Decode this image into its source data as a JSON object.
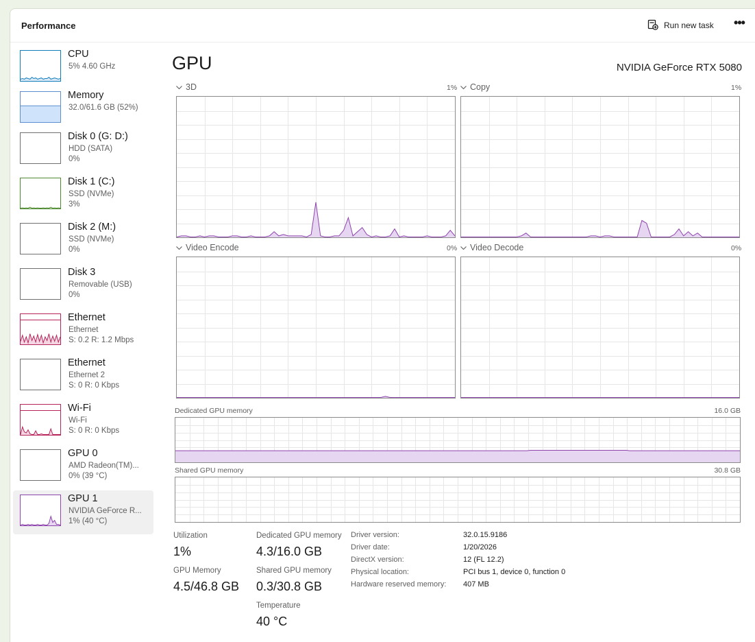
{
  "header": {
    "title": "Performance",
    "run_task_label": "Run new task",
    "more_label": "•••"
  },
  "sidebar": {
    "items": [
      {
        "name": "CPU",
        "sub1": "5%  4.60 GHz",
        "sub2": "",
        "graph": "cpu"
      },
      {
        "name": "Memory",
        "sub1": "32.0/61.6 GB (52%)",
        "sub2": "",
        "graph": "memory"
      },
      {
        "name": "Disk 0 (G: D:)",
        "sub1": "HDD (SATA)",
        "sub2": "0%",
        "graph": "empty"
      },
      {
        "name": "Disk 1 (C:)",
        "sub1": "SSD (NVMe)",
        "sub2": "3%",
        "graph": "disk1"
      },
      {
        "name": "Disk 2 (M:)",
        "sub1": "SSD (NVMe)",
        "sub2": "0%",
        "graph": "empty"
      },
      {
        "name": "Disk 3",
        "sub1": "Removable (USB)",
        "sub2": "0%",
        "graph": "empty"
      },
      {
        "name": "Ethernet",
        "sub1": "Ethernet",
        "sub2": "S: 0.2  R: 1.2 Mbps",
        "graph": "ethernet"
      },
      {
        "name": "Ethernet",
        "sub1": "Ethernet 2",
        "sub2": "S: 0  R: 0 Kbps",
        "graph": "empty"
      },
      {
        "name": "Wi-Fi",
        "sub1": "Wi-Fi",
        "sub2": "S: 0  R: 0 Kbps",
        "graph": "wifi"
      },
      {
        "name": "GPU 0",
        "sub1": "AMD Radeon(TM)...",
        "sub2": "0%  (39 °C)",
        "graph": "empty"
      },
      {
        "name": "GPU 1",
        "sub1": "NVIDIA GeForce R...",
        "sub2": "1%  (40 °C)",
        "graph": "gpu1"
      }
    ],
    "selected_index": 10
  },
  "main": {
    "heading": "GPU",
    "model": "NVIDIA GeForce RTX 5080",
    "engines": [
      {
        "label": "3D",
        "percent": "1%",
        "series": [
          0,
          1,
          1,
          0,
          0,
          1,
          0,
          1,
          1,
          0,
          0,
          0,
          1,
          1,
          0,
          0,
          1,
          0,
          0,
          0,
          1,
          4,
          1,
          2,
          1,
          1,
          1,
          1,
          0,
          2,
          25,
          1,
          0,
          0,
          1,
          1,
          5,
          14,
          1,
          4,
          7,
          2,
          0,
          1,
          0,
          0,
          1,
          6,
          0,
          1,
          0,
          0,
          0,
          0,
          1,
          0,
          0,
          0,
          1,
          5,
          1
        ]
      },
      {
        "label": "Copy",
        "percent": "1%",
        "series": [
          0,
          0,
          0,
          0,
          0,
          0,
          0,
          0,
          0,
          0,
          0,
          0,
          0,
          1,
          3,
          0,
          0,
          0,
          0,
          0,
          0,
          0,
          0,
          0,
          0,
          0,
          0,
          0,
          1,
          1,
          0,
          1,
          1,
          0,
          0,
          0,
          0,
          0,
          0,
          12,
          10,
          0,
          0,
          0,
          0,
          0,
          2,
          6,
          1,
          4,
          1,
          3,
          0,
          0,
          0,
          0,
          0,
          0,
          0,
          0,
          0
        ]
      },
      {
        "label": "Video Encode",
        "percent": "0%",
        "series": [
          0,
          0,
          0,
          0,
          0,
          0,
          0,
          0,
          0,
          0,
          0,
          0,
          0,
          0,
          0,
          0,
          0,
          0,
          0,
          0,
          0,
          0,
          0,
          0,
          0,
          0,
          0,
          0,
          0,
          0,
          0,
          0,
          0,
          0,
          0,
          0,
          0,
          0,
          0,
          0,
          0,
          0,
          0,
          0,
          0,
          1,
          0,
          0,
          0,
          0,
          0,
          0,
          0,
          0,
          0,
          0,
          0,
          0,
          0,
          0,
          0
        ]
      },
      {
        "label": "Video Decode",
        "percent": "0%",
        "series": [
          0,
          0,
          0,
          0,
          0,
          0,
          0,
          0,
          0,
          0,
          0,
          0,
          0,
          0,
          0,
          0,
          0,
          0,
          0,
          0,
          0,
          0,
          0,
          0,
          0,
          0,
          0,
          0,
          0,
          0,
          0,
          0,
          0,
          0,
          0,
          0,
          0,
          0,
          0,
          0,
          0,
          0,
          0,
          0,
          0,
          0,
          0,
          0,
          0,
          0,
          0,
          0,
          0,
          0,
          0,
          0,
          0,
          0,
          0,
          0,
          0
        ]
      }
    ],
    "dedicated_memory": {
      "label": "Dedicated GPU memory",
      "max": "16.0 GB",
      "series": [
        26,
        26,
        26,
        26,
        26,
        26,
        26,
        26,
        26,
        26,
        26,
        26,
        26,
        26,
        26,
        26,
        26,
        26,
        26,
        26,
        26,
        26,
        26,
        26,
        26,
        26,
        26,
        26,
        26,
        26,
        26,
        26,
        26,
        26,
        26,
        26,
        26,
        26,
        26,
        26,
        26,
        26,
        26,
        26,
        26,
        26,
        26,
        26,
        26,
        26,
        26,
        26,
        26,
        26,
        26,
        26,
        26,
        26,
        26,
        26,
        26,
        26,
        26,
        26,
        26,
        26,
        26,
        26,
        26,
        26,
        26,
        26,
        26,
        26,
        26,
        26,
        26,
        26,
        26,
        26,
        26,
        26,
        26,
        26,
        26,
        26,
        26,
        26,
        26,
        26,
        26,
        26,
        26,
        26,
        26,
        26,
        26,
        26,
        26,
        26,
        27,
        27,
        27,
        27,
        27,
        27,
        27,
        27,
        27,
        27,
        27,
        27,
        27,
        27,
        27,
        27,
        27,
        27,
        27,
        27,
        27,
        27,
        27,
        27,
        27,
        27,
        27,
        27,
        26,
        26,
        26,
        26,
        26,
        26,
        26,
        26,
        26,
        26,
        26,
        26,
        26,
        26,
        26,
        26,
        26,
        26,
        26,
        26,
        26,
        26,
        26,
        26,
        26,
        26,
        26,
        26,
        26,
        26,
        26,
        26
      ]
    },
    "shared_memory": {
      "label": "Shared GPU memory",
      "max": "30.8 GB",
      "series": [
        0
      ]
    },
    "stats": {
      "utilization_label": "Utilization",
      "utilization_value": "1%",
      "gpu_memory_label": "GPU Memory",
      "gpu_memory_value": "4.5/46.8 GB",
      "dedicated_label": "Dedicated GPU memory",
      "dedicated_value": "4.3/16.0 GB",
      "shared_label": "Shared GPU memory",
      "shared_value": "0.3/30.8 GB",
      "temperature_label": "Temperature",
      "temperature_value": "40 °C"
    },
    "info": [
      {
        "key": "Driver version:",
        "value": "32.0.15.9186"
      },
      {
        "key": "Driver date:",
        "value": "1/20/2026"
      },
      {
        "key": "DirectX version:",
        "value": "12 (FL 12.2)"
      },
      {
        "key": "Physical location:",
        "value": "PCI bus 1, device 0, function 0"
      },
      {
        "key": "Hardware reserved memory:",
        "value": "407 MB"
      }
    ]
  },
  "colors": {
    "gpu_line": "#8e44ad",
    "gpu_fill": "#e6d6f1",
    "cpu_line": "#117dbb",
    "memory_fill": "#cfe3fa",
    "memory_line": "#5b8fd0",
    "disk_line": "#4d8a2f",
    "net_line": "#b7245c",
    "grid": "#e6e6e6",
    "accent_bg": "#eef3e8"
  }
}
